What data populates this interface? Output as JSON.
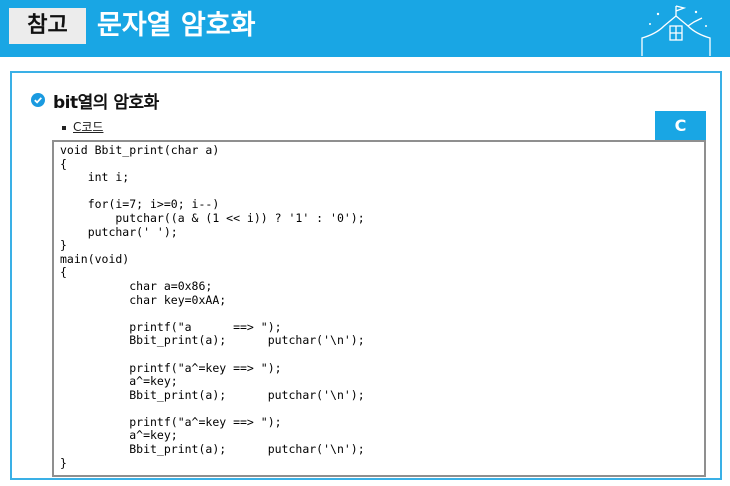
{
  "header": {
    "badge": "참고",
    "title": "문자열 암호화",
    "bg_color": "#19a6e4",
    "decoration_icon": "school-building-icon"
  },
  "section": {
    "icon": "check-circle-icon",
    "title": "bit열의 암호화",
    "bullet": "C코드",
    "lang_tab": "C"
  },
  "code": {
    "lines": [
      "void Bbit_print(char a)",
      "{",
      "    int i;",
      "",
      "    for(i=7; i>=0; i--)",
      "        putchar((a & (1 << i)) ? '1' : '0');",
      "    putchar(' ');",
      "}",
      "main(void)",
      "{",
      "          char a=0x86;",
      "          char key=0xAA;",
      "",
      "          printf(\"a      ==> \");",
      "          Bbit_print(a);      putchar('\\n');",
      "",
      "          printf(\"a^=key ==> \");",
      "          a^=key;",
      "          Bbit_print(a);      putchar('\\n');",
      "",
      "          printf(\"a^=key ==> \");",
      "          a^=key;",
      "          Bbit_print(a);      putchar('\\n');",
      "}"
    ]
  }
}
